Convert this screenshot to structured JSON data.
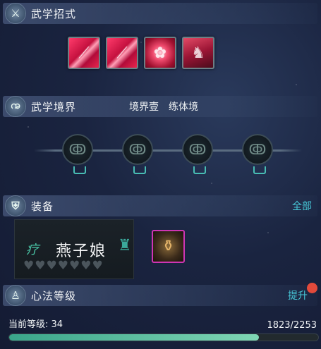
{
  "skills_section": {
    "title": "武学招式",
    "icon": "sword-icon"
  },
  "skills": [
    {
      "name": "skill-slash-1",
      "icon": "slash-icon"
    },
    {
      "name": "skill-slash-2",
      "icon": "slash-icon"
    },
    {
      "name": "skill-rose",
      "icon": "rose-icon"
    },
    {
      "name": "skill-figure",
      "icon": "warrior-icon"
    }
  ],
  "realm_section": {
    "title": "武学境界",
    "icon": "swirl-icon",
    "realm_name": "境界壹",
    "realm_stage": "练体境"
  },
  "realm_nodes": [
    {
      "name": "realm-node-1",
      "icon": "swirl-locked-icon"
    },
    {
      "name": "realm-node-2",
      "icon": "swirl-locked-icon"
    },
    {
      "name": "realm-node-3",
      "icon": "swirl-locked-icon"
    },
    {
      "name": "realm-node-4",
      "icon": "swirl-locked-icon"
    }
  ],
  "equip_section": {
    "title": "装备",
    "icon": "armor-icon",
    "all_label": "全部"
  },
  "equipment": {
    "tag": "疗",
    "name": "燕子娘",
    "hearts_total": 7,
    "hearts_filled": 0,
    "item_icon": "treasure-chest-icon"
  },
  "mind_section": {
    "title": "心法等级",
    "icon": "meditation-icon",
    "action_label": "提升"
  },
  "level": {
    "label": "当前等级: 34",
    "exp_text": "1823/2253",
    "progress": 0.809
  },
  "colors": {
    "accent": "#47c8d8",
    "progress": "#5fc7a2",
    "notify": "#e24a3b",
    "rare_border": "#cf35b3"
  }
}
